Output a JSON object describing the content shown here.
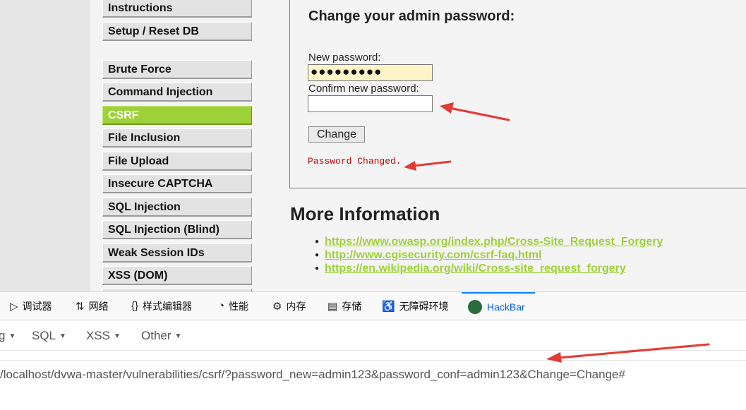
{
  "sidebar": {
    "items": [
      {
        "label": "Instructions"
      },
      {
        "label": "Setup / Reset DB"
      },
      {
        "label": "Brute Force"
      },
      {
        "label": "Command Injection"
      },
      {
        "label": "CSRF",
        "active": true
      },
      {
        "label": "File Inclusion"
      },
      {
        "label": "File Upload"
      },
      {
        "label": "Insecure CAPTCHA"
      },
      {
        "label": "SQL Injection"
      },
      {
        "label": "SQL Injection (Blind)"
      },
      {
        "label": "Weak Session IDs"
      },
      {
        "label": "XSS (DOM)"
      }
    ]
  },
  "csrf_form": {
    "title": "Change your admin password:",
    "new_password_label": "New password:",
    "new_password_value": "●●●●●●●●●",
    "confirm_password_label": "Confirm new password:",
    "confirm_password_value": "",
    "change_button": "Change",
    "result_message": "Password Changed."
  },
  "more_info": {
    "heading": "More Information",
    "links": [
      "https://www.owasp.org/index.php/Cross-Site_Request_Forgery",
      "http://www.cgisecurity.com/csrf-faq.html",
      "https://en.wikipedia.org/wiki/Cross-site_request_forgery"
    ]
  },
  "devtools": {
    "tabs": [
      {
        "label": "调试器",
        "icon": "debugger-icon"
      },
      {
        "label": "网络",
        "icon": "network-icon"
      },
      {
        "label": "样式编辑器",
        "icon": "style-editor-icon"
      },
      {
        "label": "性能",
        "icon": "performance-icon"
      },
      {
        "label": "内存",
        "icon": "memory-icon"
      },
      {
        "label": "存储",
        "icon": "storage-icon"
      },
      {
        "label": "无障碍环境",
        "icon": "accessibility-icon"
      },
      {
        "label": "HackBar",
        "icon": "hackbar-icon",
        "selected": true
      }
    ]
  },
  "hackbar": {
    "menus": [
      "g",
      "SQL",
      "XSS",
      "Other"
    ],
    "url": "/localhost/dvwa-master/vulnerabilities/csrf/?password_new=admin123&password_conf=admin123&Change=Change#"
  },
  "colors": {
    "accent_green": "#9ed13a",
    "annotation_red": "#e53935",
    "message_red": "#d00000",
    "hackbar_blue": "#0060df"
  }
}
